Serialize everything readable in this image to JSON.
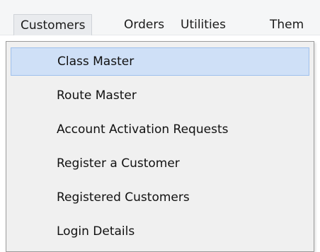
{
  "menubar": {
    "items": [
      {
        "label": "Customers"
      },
      {
        "label": "Orders"
      },
      {
        "label": "Utilities"
      },
      {
        "label": "Them"
      }
    ]
  },
  "dropdown": {
    "items": [
      {
        "label": "Class Master"
      },
      {
        "label": "Route Master"
      },
      {
        "label": "Account Activation Requests"
      },
      {
        "label": "Register a Customer"
      },
      {
        "label": "Registered Customers"
      },
      {
        "label": "Login Details"
      }
    ],
    "highlight_color": "#cfe0f7"
  }
}
